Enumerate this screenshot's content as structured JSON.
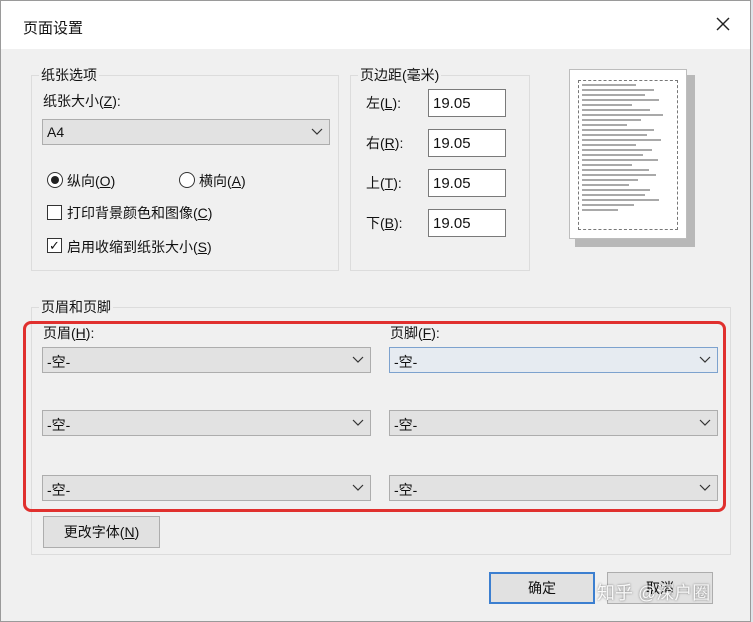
{
  "dialog": {
    "title": "页面设置",
    "close_icon": "close-icon"
  },
  "paper": {
    "group_title": "纸张选项",
    "size_label": "纸张大小(",
    "size_key": "Z",
    "size_suffix": "):",
    "size_value": "A4",
    "portrait_label": "纵向(",
    "portrait_key": "O",
    "portrait_suffix": ")",
    "portrait_selected": true,
    "landscape_label": "横向(",
    "landscape_key": "A",
    "landscape_suffix": ")",
    "bg_label": "打印背景颜色和图像(",
    "bg_key": "C",
    "bg_suffix": ")",
    "bg_checked": false,
    "shrink_label": "启用收缩到纸张大小(",
    "shrink_key": "S",
    "shrink_suffix": ")",
    "shrink_checked": true
  },
  "margins": {
    "group_title": "页边距(毫米)",
    "left_label": "左(",
    "left_key": "L",
    "left_suffix": "):",
    "left_value": "19.05",
    "right_label": "右(",
    "right_key": "R",
    "right_suffix": "):",
    "right_value": "19.05",
    "top_label": "上(",
    "top_key": "T",
    "top_suffix": "):",
    "top_value": "19.05",
    "bottom_label": "下(",
    "bottom_key": "B",
    "bottom_suffix": "):",
    "bottom_value": "19.05"
  },
  "header_footer": {
    "group_title": "页眉和页脚",
    "header_label": "页眉(",
    "header_key": "H",
    "header_suffix": "):",
    "footer_label": "页脚(",
    "footer_key": "F",
    "footer_suffix": "):",
    "header_values": [
      "-空-",
      "-空-",
      "-空-"
    ],
    "footer_values": [
      "-空-",
      "-空-",
      "-空-"
    ],
    "highlight_color": "#e0302e"
  },
  "buttons": {
    "font_label": "更改字体(",
    "font_key": "N",
    "font_suffix": ")",
    "ok_label": "确定",
    "cancel_label": "取消"
  },
  "watermark": {
    "text": "知乎 @深户圈"
  }
}
